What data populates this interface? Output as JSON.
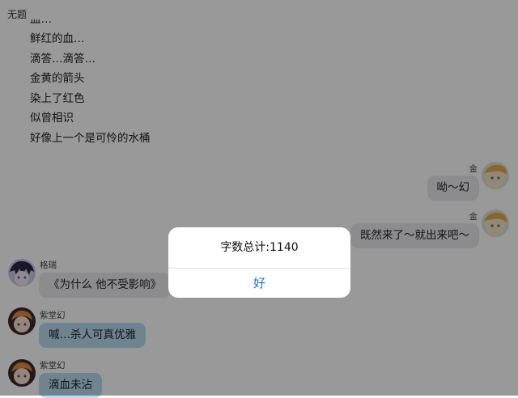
{
  "window": {
    "title": "无题"
  },
  "narration": [
    "血…",
    "鲜红的血…",
    "滴答…滴答…",
    "金黄的箭头",
    "染上了红色",
    "似曾相识",
    "好像上一个是可怜的水桶"
  ],
  "messages": [
    {
      "side": "right",
      "name": "金",
      "text": "呦～幻"
    },
    {
      "side": "right",
      "name": "金",
      "text": "既然来了～就出来吧～"
    },
    {
      "side": "left",
      "name": "格瑞",
      "text": "《为什么 他不受影响》"
    },
    {
      "side": "left",
      "name": "紫堂幻",
      "text": "喊…杀人可真优雅"
    },
    {
      "side": "left",
      "name": "紫堂幻",
      "text": "滴血未沾"
    }
  ],
  "dialog": {
    "message": "字数总计:1140",
    "button": "好"
  },
  "colors": {
    "bubble_gray": "#e9eaee",
    "bubble_blue": "#b8dcf2",
    "dialog_button": "#1a74d4",
    "overlay": "rgba(0,0,0,0.40)"
  },
  "icons": {
    "avatar_jin": "avatar-icon",
    "avatar_gerui": "avatar-icon",
    "avatar_zitanghuan": "avatar-icon"
  }
}
